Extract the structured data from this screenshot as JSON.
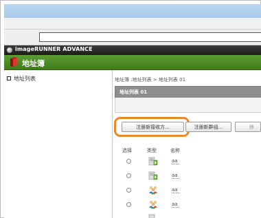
{
  "brand": {
    "name": "imageRUNNER ADVANCE"
  },
  "page": {
    "title": "地址簿"
  },
  "sidebar": {
    "items": [
      {
        "label": "地址列表"
      }
    ]
  },
  "breadcrumb": "地址簿 :地址列表 > 地址列表 01",
  "list": {
    "title": "地址列表 01"
  },
  "buttons": {
    "new_destination": "注册新接收方...",
    "new_group": "注册新群组...",
    "more": "移"
  },
  "table": {
    "headers": {
      "select": "选择",
      "type": "类型",
      "name": "名称"
    },
    "rows": [
      {
        "type_icon": "server-folder-icon",
        "name": "aa"
      },
      {
        "type_icon": "server-folder-icon",
        "name": "aa"
      },
      {
        "type_icon": "group-icon",
        "name": "aa"
      },
      {
        "type_icon": "group-icon",
        "name": "aa"
      }
    ]
  },
  "colors": {
    "header_green": "#4f8c27",
    "highlight_orange": "#e88a25",
    "brand_black": "#1c1c1c"
  }
}
